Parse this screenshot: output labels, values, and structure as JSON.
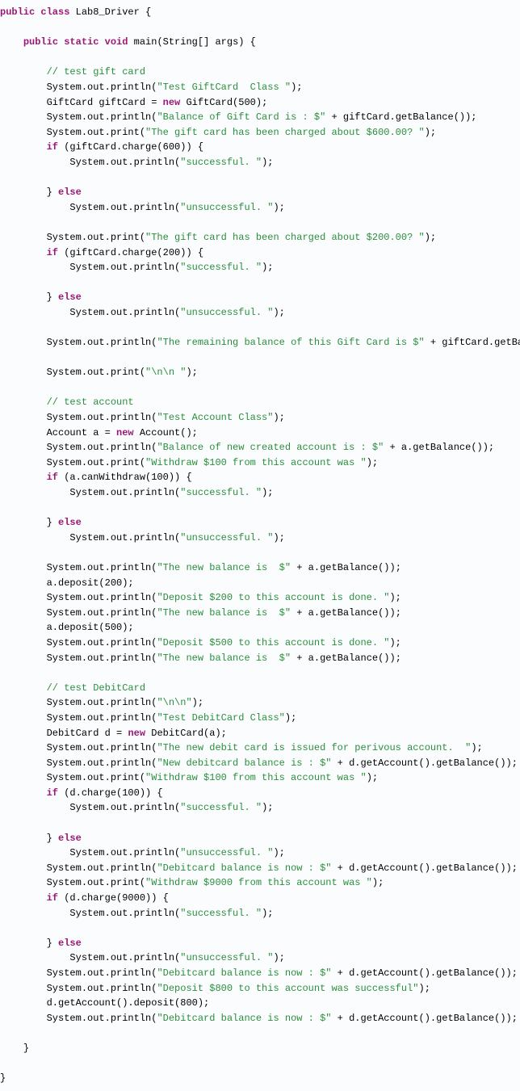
{
  "code": {
    "class_decl": {
      "p": "public class",
      "name": "Lab8_Driver",
      "b": "{"
    },
    "main_sig": {
      "p": "public static void",
      "name": "main",
      "args": "(String[] args) {"
    },
    "c1": "// test gift card",
    "l1": {
      "pre": "System.out.println(",
      "s": "\"Test GiftCard  Class \"",
      "post": ");"
    },
    "l2": {
      "pre": "GiftCard giftCard = ",
      "kw": "new",
      "post": " GiftCard(500);"
    },
    "l3": {
      "pre": "System.out.println(",
      "s": "\"Balance of Gift Card is : $\"",
      "post": " + giftCard.getBalance());"
    },
    "l4": {
      "pre": "System.out.print(",
      "s": "\"The gift card has been charged about $600.00? \"",
      "post": ");"
    },
    "l5": {
      "kw": "if",
      "post": " (giftCard.charge(600)) {"
    },
    "l6": {
      "pre": "System.out.println(",
      "s": "\"successful. \"",
      "post": ");"
    },
    "l7": {
      "pre": "} ",
      "kw": "else"
    },
    "l8": {
      "pre": "System.out.println(",
      "s": "\"unsuccessful. \"",
      "post": ");"
    },
    "l9": {
      "pre": "System.out.print(",
      "s": "\"The gift card has been charged about $200.00? \"",
      "post": ");"
    },
    "l10": {
      "kw": "if",
      "post": " (giftCard.charge(200)) {"
    },
    "l11": {
      "pre": "System.out.println(",
      "s": "\"successful. \"",
      "post": ");"
    },
    "l12": {
      "pre": "} ",
      "kw": "else"
    },
    "l13": {
      "pre": "System.out.println(",
      "s": "\"unsuccessful. \"",
      "post": ");"
    },
    "l14": {
      "pre": "System.out.println(",
      "s": "\"The remaining balance of this Gift Card is $\"",
      "post": " + giftCard.getBalance());"
    },
    "l15": {
      "pre": "System.out.print(",
      "s": "\"\\n\\n \"",
      "post": ");"
    },
    "c2": "// test account",
    "l16": {
      "pre": "System.out.println(",
      "s": "\"Test Account Class\"",
      "post": ");"
    },
    "l17": {
      "pre": "Account a = ",
      "kw": "new",
      "post": " Account();"
    },
    "l18": {
      "pre": "System.out.println(",
      "s": "\"Balance of new created account is : $\"",
      "post": " + a.getBalance());"
    },
    "l19": {
      "pre": "System.out.print(",
      "s": "\"Withdraw $100 from this account was \"",
      "post": ");"
    },
    "l20": {
      "kw": "if",
      "post": " (a.canWithdraw(100)) {"
    },
    "l21": {
      "pre": "System.out.println(",
      "s": "\"successful. \"",
      "post": ");"
    },
    "l22": {
      "pre": "} ",
      "kw": "else"
    },
    "l23": {
      "pre": "System.out.println(",
      "s": "\"unsuccessful. \"",
      "post": ");"
    },
    "l24": {
      "pre": "System.out.println(",
      "s": "\"The new balance is  $\"",
      "post": " + a.getBalance());"
    },
    "l25": {
      "pre": "a.deposit(200);"
    },
    "l26": {
      "pre": "System.out.println(",
      "s": "\"Deposit $200 to this account is done. \"",
      "post": ");"
    },
    "l27": {
      "pre": "System.out.println(",
      "s": "\"The new balance is  $\"",
      "post": " + a.getBalance());"
    },
    "l28": {
      "pre": "a.deposit(500);"
    },
    "l29": {
      "pre": "System.out.println(",
      "s": "\"Deposit $500 to this account is done. \"",
      "post": ");"
    },
    "l30": {
      "pre": "System.out.println(",
      "s": "\"The new balance is  $\"",
      "post": " + a.getBalance());"
    },
    "c3": "// test DebitCard",
    "l31": {
      "pre": "System.out.println(",
      "s": "\"\\n\\n\"",
      "post": ");"
    },
    "l32": {
      "pre": "System.out.println(",
      "s": "\"Test DebitCard Class\"",
      "post": ");"
    },
    "l33": {
      "pre": "DebitCard d = ",
      "kw": "new",
      "post": " DebitCard(a);"
    },
    "l34": {
      "pre": "System.out.println(",
      "s": "\"The new debit card is issued for perivous account.  \"",
      "post": ");"
    },
    "l35": {
      "pre": "System.out.println(",
      "s": "\"New debitcard balance is : $\"",
      "post": " + d.getAccount().getBalance());"
    },
    "l36": {
      "pre": "System.out.print(",
      "s": "\"Withdraw $100 from this account was \"",
      "post": ");"
    },
    "l37": {
      "kw": "if",
      "post": " (d.charge(100)) {"
    },
    "l38": {
      "pre": "System.out.println(",
      "s": "\"successful. \"",
      "post": ");"
    },
    "l39": {
      "pre": "} ",
      "kw": "else"
    },
    "l40": {
      "pre": "System.out.println(",
      "s": "\"unsuccessful. \"",
      "post": ");"
    },
    "l41": {
      "pre": "System.out.println(",
      "s": "\"Debitcard balance is now : $\"",
      "post": " + d.getAccount().getBalance());"
    },
    "l42": {
      "pre": "System.out.print(",
      "s": "\"Withdraw $9000 from this account was \"",
      "post": ");"
    },
    "l43": {
      "kw": "if",
      "post": " (d.charge(9000)) {"
    },
    "l44": {
      "pre": "System.out.println(",
      "s": "\"successful. \"",
      "post": ");"
    },
    "l45": {
      "pre": "} ",
      "kw": "else"
    },
    "l46": {
      "pre": "System.out.println(",
      "s": "\"unsuccessful. \"",
      "post": ");"
    },
    "l47": {
      "pre": "System.out.println(",
      "s": "\"Debitcard balance is now : $\"",
      "post": " + d.getAccount().getBalance());"
    },
    "l48": {
      "pre": "System.out.println(",
      "s": "\"Deposit $800 to this account was successful\"",
      "post": ");"
    },
    "l49": {
      "pre": "d.getAccount().deposit(800);"
    },
    "l50": {
      "pre": "System.out.println(",
      "s": "\"Debitcard balance is now : $\"",
      "post": " + d.getAccount().getBalance());"
    },
    "close_main": "}",
    "close_class": "}"
  }
}
